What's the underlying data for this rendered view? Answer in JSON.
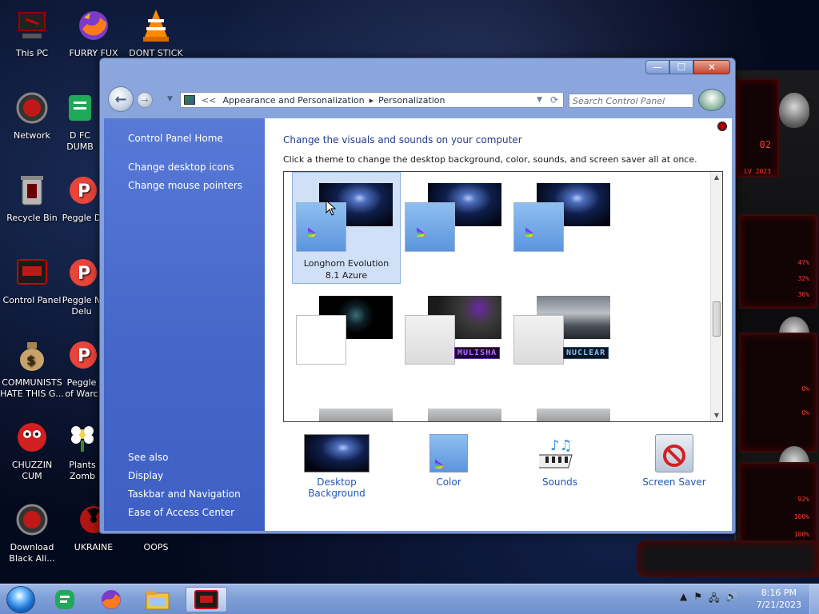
{
  "desktop": {
    "icons": [
      {
        "label": "This PC"
      },
      {
        "label": "FURRY FUX"
      },
      {
        "label": "DONT STICK"
      },
      {
        "label": "Network"
      },
      {
        "label": "D FC\nDUMB"
      },
      {
        "label": "Recycle Bin"
      },
      {
        "label": "Peggle D"
      },
      {
        "label": "Control Panel"
      },
      {
        "label": "Peggle N\nDelu"
      },
      {
        "label": "COMMUNISTS\nHATE THIS G..."
      },
      {
        "label": "Peggle\nof Warc"
      },
      {
        "label": "CHUZZIN\nCUM"
      },
      {
        "label": "Plants\nZomb"
      },
      {
        "label": "Download\nBlack Ali..."
      },
      {
        "label": "UKRAINE"
      },
      {
        "label": "OOPS"
      }
    ]
  },
  "window": {
    "breadcrumb": {
      "overflow": "<<",
      "item1": "Appearance and Personalization",
      "separator": "▸",
      "item2": "Personalization"
    },
    "search_placeholder": "Search Control Panel",
    "controls": {
      "minimize": "—",
      "maximize": "☐",
      "close": "✕"
    }
  },
  "sidebar": {
    "home": "Control Panel Home",
    "links": [
      "Change desktop icons",
      "Change mouse pointers"
    ],
    "see_also_title": "See also",
    "see_also": [
      "Display",
      "Taskbar and Navigation",
      "Ease of Access Center"
    ]
  },
  "content": {
    "title": "Change the visuals and sounds on your computer",
    "subtitle": "Click a theme to change the desktop background, color, sounds, and screen saver all at once.",
    "themes": [
      {
        "name": "Longhorn Evolution\n8.1 Azure",
        "selected": true
      },
      {
        "name": ""
      },
      {
        "name": ""
      },
      {
        "name": "",
        "badge": ""
      },
      {
        "name": "",
        "badge": "MULISHA"
      },
      {
        "name": "",
        "badge": "NUCLEAR"
      }
    ],
    "options": [
      {
        "label": "Desktop Background"
      },
      {
        "label": "Color"
      },
      {
        "label": "Sounds"
      },
      {
        "label": "Screen Saver"
      }
    ]
  },
  "taskbar": {
    "time": "8:16 PM",
    "date": "7/21/2023",
    "pinned": [
      "start",
      "notes",
      "firefox",
      "explorer",
      "alienware"
    ]
  },
  "alien_panel": {
    "readouts": [
      "02",
      "LV 2023",
      "47%",
      "32%",
      "36%",
      "0%",
      "0%",
      "92%",
      "100%",
      "100%"
    ]
  },
  "colors": {
    "sidebar": "#4567c9",
    "link": "#1f56b8",
    "title": "#1f3b8f",
    "selection": "#cfe0f7"
  }
}
